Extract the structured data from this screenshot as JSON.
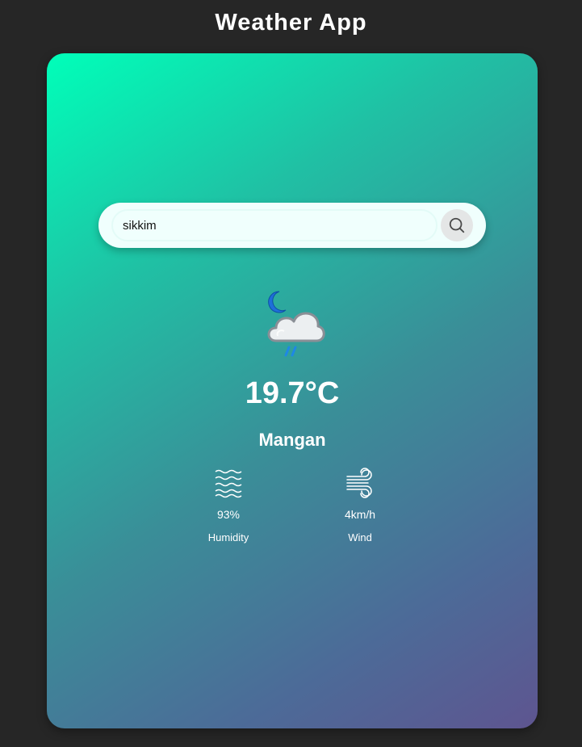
{
  "header": {
    "title": "Weather App"
  },
  "search": {
    "value": "sikkim",
    "button_icon": "search-icon"
  },
  "weather": {
    "icon": "night-rain-cloud-icon",
    "temperature": "19.7°C",
    "location": "Mangan"
  },
  "stats": {
    "humidity": {
      "icon": "humidity-waves-icon",
      "value": "93%",
      "label": "Humidity"
    },
    "wind": {
      "icon": "wind-icon",
      "value": "4km/h",
      "label": "Wind"
    }
  },
  "colors": {
    "background": "#262626",
    "card_gradient_start": "#00ffb9",
    "card_gradient_end": "#5e5590",
    "search_bg": "#f0fffd",
    "text": "#ffffff"
  }
}
